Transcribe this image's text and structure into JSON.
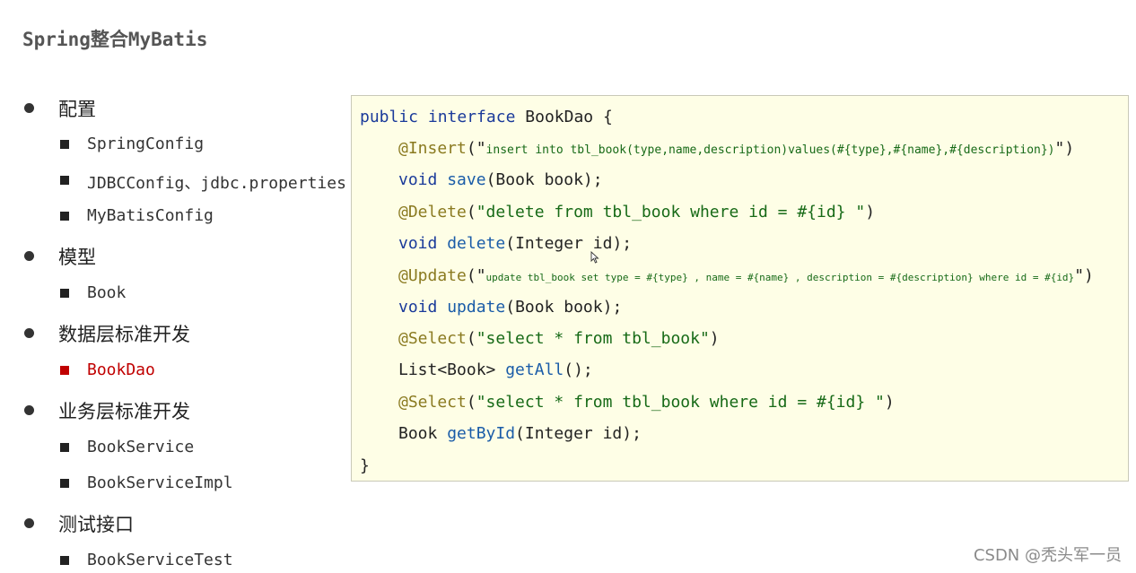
{
  "title": "Spring整合MyBatis",
  "outline": [
    {
      "label": "配置",
      "children": [
        {
          "label": "SpringConfig",
          "active": false
        },
        {
          "label": "JDBCConfig、jdbc.properties",
          "active": false
        },
        {
          "label": "MyBatisConfig",
          "active": false
        }
      ]
    },
    {
      "label": "模型",
      "children": [
        {
          "label": "Book",
          "active": false
        }
      ]
    },
    {
      "label": "数据层标准开发",
      "children": [
        {
          "label": "BookDao",
          "active": true
        }
      ]
    },
    {
      "label": "业务层标准开发",
      "children": [
        {
          "label": "BookService",
          "active": false
        },
        {
          "label": "BookServiceImpl",
          "active": false
        }
      ]
    },
    {
      "label": "测试接口",
      "children": [
        {
          "label": "BookServiceTest",
          "active": false
        }
      ]
    }
  ],
  "code": {
    "l1_kw1": "public",
    "l1_kw2": "interface",
    "l1_name": "BookDao {",
    "insert_ann": "@Insert",
    "insert_sql": "insert into tbl_book(type,name,description)values(#{type},#{name},#{description})",
    "save_kw": "void",
    "save_fn": "save",
    "save_args": "(Book book);",
    "delete_ann": "@Delete",
    "delete_sql": "\"delete from tbl_book where id = #{id} \"",
    "delete_kw": "void",
    "delete_fn": "delete",
    "delete_args": "(Integer id);",
    "update_ann": "@Update",
    "update_sql": "update tbl_book set type = #{type} , name = #{name} , description = #{description} where id = #{id}",
    "update_kw": "void",
    "update_fn": "update",
    "update_args": "(Book book);",
    "select1_ann": "@Select",
    "select1_sql": "\"select * from tbl_book\"",
    "getall_type": "List<Book> ",
    "getall_fn": "getAll",
    "getall_args": "();",
    "select2_ann": "@Select",
    "select2_sql": "\"select * from tbl_book where id = #{id} \"",
    "getbyid_type": "Book ",
    "getbyid_fn": "getById",
    "getbyid_args": "(Integer id);",
    "close": "}"
  },
  "watermark": "CSDN @秃头军一员",
  "colors": {
    "keyword": "#1a3a9a",
    "annotation": "#8a7a20",
    "string": "#176a17",
    "active_item": "#c00000",
    "code_bg": "#fefee6"
  }
}
